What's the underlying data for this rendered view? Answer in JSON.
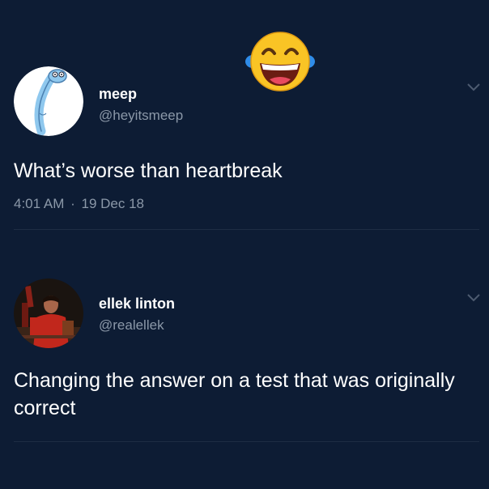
{
  "tweet1": {
    "name": "meep",
    "handle": "@heyitsmeep",
    "text": "What’s worse than heartbreak",
    "time": "4:01 AM",
    "separator": "·",
    "date": "19 Dec 18"
  },
  "tweet2": {
    "name": "ellek linton",
    "handle": "@realellek",
    "text": "Changing the answer on a test that was originally correct"
  },
  "icons": {
    "reaction": "tears-of-joy-emoji",
    "menu": "chevron-down-icon"
  },
  "colors": {
    "background": "#0d1c34",
    "text": "#ffffff",
    "muted": "#8b98a8",
    "divider": "#1e2d44"
  }
}
